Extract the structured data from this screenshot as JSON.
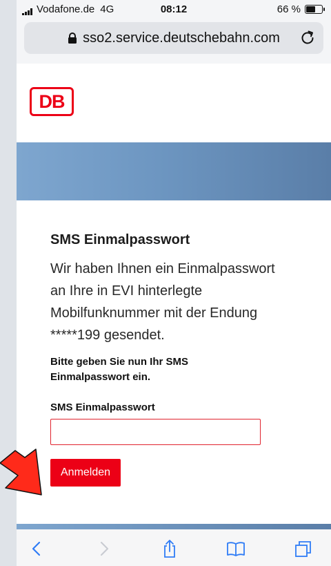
{
  "status_bar": {
    "carrier": "Vodafone.de",
    "network": "4G",
    "time": "08:12",
    "battery": "66 %",
    "battery_level": 0.66
  },
  "browser": {
    "url": "sso2.service.deutschebahn.com",
    "toolbar_icons": [
      "back-icon",
      "forward-icon",
      "share-icon",
      "bookmarks-icon",
      "tabs-icon"
    ]
  },
  "page": {
    "logo": "DB",
    "heading": "SMS Einmalpasswort",
    "intro_lines": [
      "Wir haben Ihnen ein Einmalpasswort",
      "an Ihre in EVI hinterlegte",
      "Mobilfunknummer mit der Endung",
      "*****199 gesendet."
    ],
    "instruction_lines": [
      "Bitte geben Sie nun Ihr SMS",
      "Einmalpasswort ein."
    ],
    "field_label": "SMS Einmalpasswort",
    "field_value": "",
    "submit_label": "Anmelden"
  },
  "colors": {
    "brand_red": "#ec0016",
    "banner_blue": "#6d96c1",
    "ios_blue": "#2f7cf6"
  }
}
